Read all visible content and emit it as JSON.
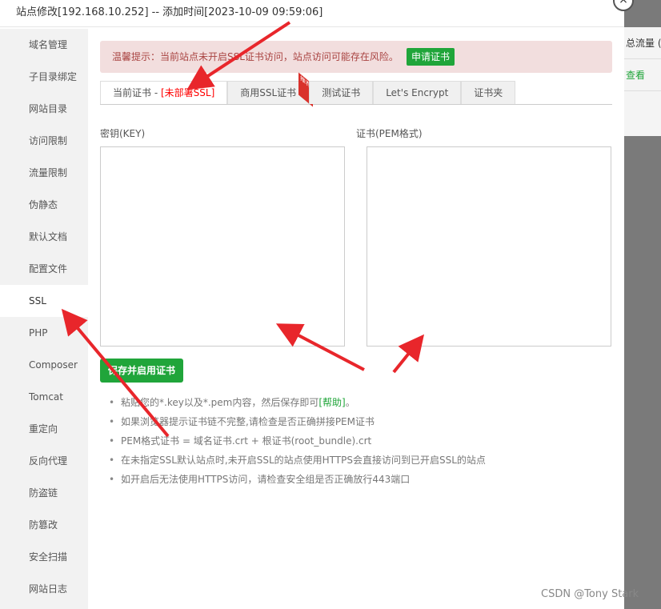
{
  "title": "站点修改[192.168.10.252] -- 添加时间[2023-10-09 09:59:06]",
  "close_icon": "×",
  "background": {
    "col1": "总流量 (",
    "col2": "查看"
  },
  "sidebar": {
    "items": [
      "域名管理",
      "子目录绑定",
      "网站目录",
      "访问限制",
      "流量限制",
      "伪静态",
      "默认文档",
      "配置文件",
      "SSL",
      "PHP",
      "Composer",
      "Tomcat",
      "重定向",
      "反向代理",
      "防盗链",
      "防篡改",
      "安全扫描",
      "网站日志"
    ],
    "active": "SSL"
  },
  "alert": {
    "text": "温馨提示：当前站点未开启SSL证书访问，站点访问可能存在风险。",
    "button": "申请证书"
  },
  "tabs": {
    "current_prefix": "当前证书 - ",
    "current_status": "[未部署SSL]",
    "commercial": "商用SSL证书",
    "badge": "推荐",
    "test": "测试证书",
    "letsencrypt": "Let's Encrypt",
    "folder": "证书夹"
  },
  "key_label": "密钥(KEY)",
  "cert_label": "证书(PEM格式)",
  "save_button": "保存并启用证书",
  "tips": {
    "t1_pre": "粘贴您的*.key以及*.pem内容，然后保存即可",
    "t1_link": "[帮助]",
    "t1_post": "。",
    "t2": "如果浏览器提示证书链不完整,请检查是否正确拼接PEM证书",
    "t3": "PEM格式证书 = 域名证书.crt + 根证书(root_bundle).crt",
    "t4": "在未指定SSL默认站点时,未开启SSL的站点使用HTTPS会直接访问到已开启SSL的站点",
    "t5": "如开启后无法使用HTTPS访问，请检查安全组是否正确放行443端口"
  },
  "watermark": "CSDN @Tony Stark",
  "colors": {
    "accent": "#20a53a",
    "annotation": "#e8262b"
  }
}
